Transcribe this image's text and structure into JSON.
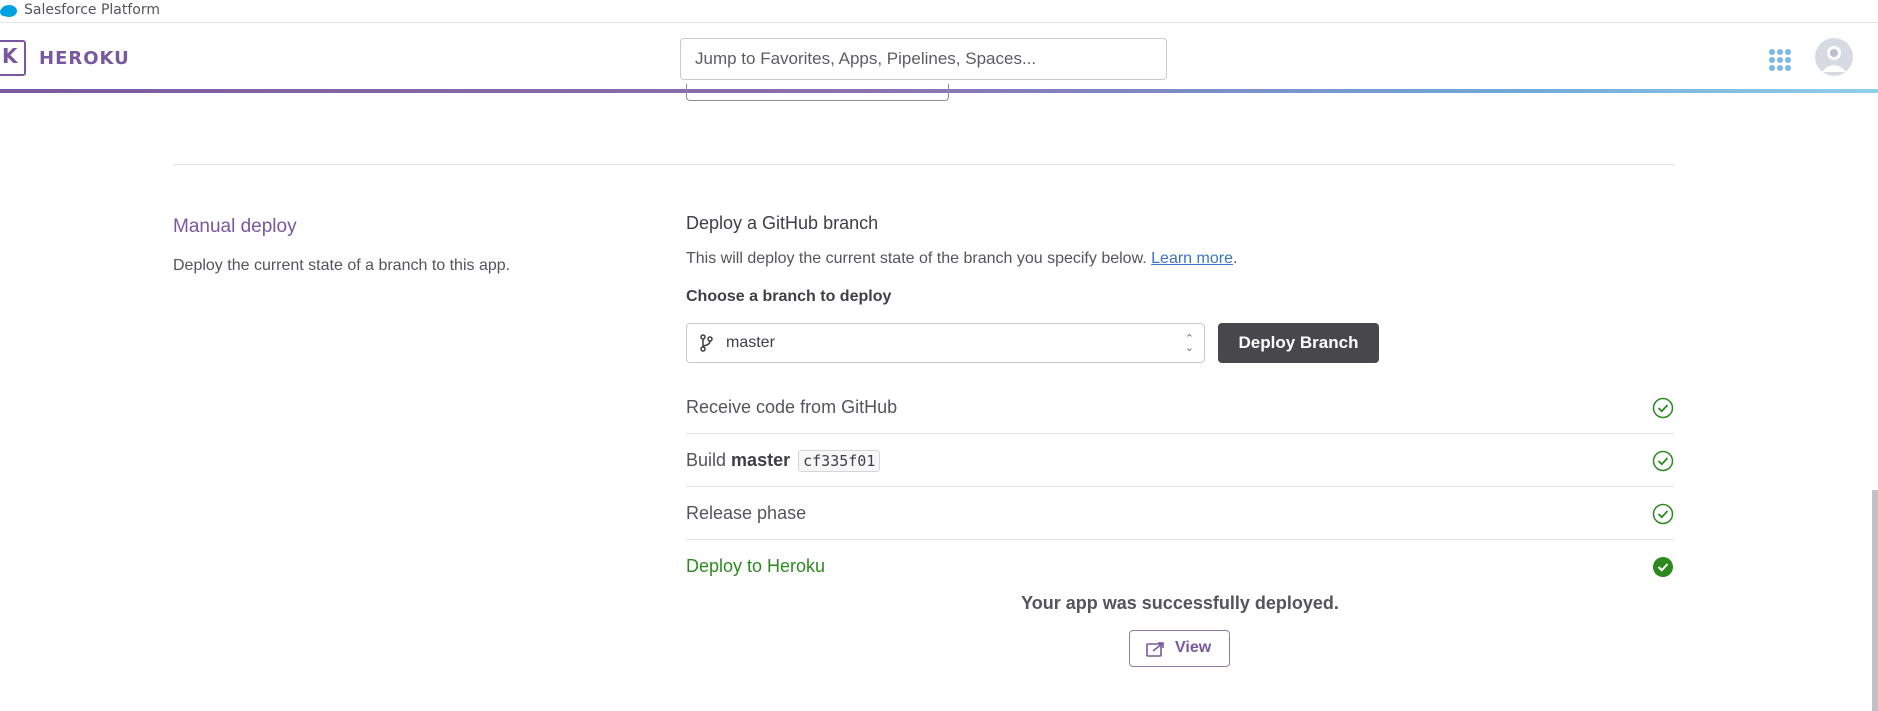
{
  "platform_bar": {
    "label": "Salesforce Platform"
  },
  "header": {
    "logo_letter": "K",
    "wordmark": "HEROKU",
    "search_placeholder": "Jump to Favorites, Apps, Pipelines, Spaces..."
  },
  "manual_deploy": {
    "title": "Manual deploy",
    "description": "Deploy the current state of a branch to this app.",
    "deploy_title": "Deploy a GitHub branch",
    "deploy_text": "This will deploy the current state of the branch you specify below.",
    "learn_more": "Learn more",
    "period": ".",
    "choose_label": "Choose a branch to deploy",
    "branch_value": "master",
    "deploy_button": "Deploy Branch"
  },
  "steps": [
    {
      "label": "Receive code from GitHub",
      "status": "complete"
    },
    {
      "label_prefix": "Build",
      "branch": "master",
      "commit": "cf335f01",
      "status": "complete"
    },
    {
      "label": "Release phase",
      "status": "complete"
    },
    {
      "label": "Deploy to Heroku",
      "status": "done"
    }
  ],
  "result": {
    "message": "Your app was successfully deployed.",
    "view_button": "View"
  },
  "colors": {
    "brand_purple": "#79589f",
    "success_green": "#2c8a1f",
    "link_blue": "#3c74c4"
  }
}
